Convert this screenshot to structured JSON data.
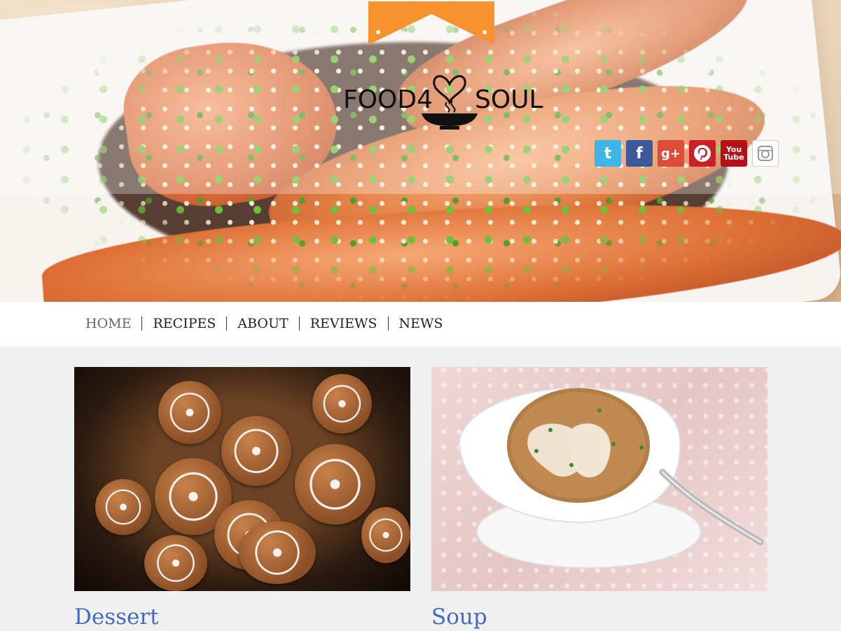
{
  "brand": {
    "name_left": "FOOD4",
    "name_right": "SOUL",
    "ribbon_color": "#f7922e"
  },
  "social": [
    {
      "name": "twitter",
      "glyph": "t",
      "color": "#3fb4e6"
    },
    {
      "name": "facebook",
      "glyph": "f",
      "color": "#3b5998"
    },
    {
      "name": "google-plus",
      "glyph": "g+",
      "color": "#dd4b39"
    },
    {
      "name": "pinterest",
      "glyph": "P",
      "color": "#cb2027"
    },
    {
      "name": "youtube",
      "glyph_top": "You",
      "glyph_bottom": "Tube",
      "color": "#b31217"
    },
    {
      "name": "instagram",
      "glyph": "",
      "color": "#ffffff"
    }
  ],
  "nav": {
    "items": [
      {
        "label": "HOME",
        "active": true
      },
      {
        "label": "RECIPES",
        "active": false
      },
      {
        "label": "ABOUT",
        "active": false
      },
      {
        "label": "REVIEWS",
        "active": false
      },
      {
        "label": "NEWS",
        "active": false
      }
    ]
  },
  "cards": [
    {
      "title": "Dessert",
      "image": "gingerbread cookies"
    },
    {
      "title": "Soup",
      "image": "wonton soup bowl"
    }
  ],
  "colors": {
    "link": "#4169c8",
    "page_bg": "#f0f0f0"
  }
}
